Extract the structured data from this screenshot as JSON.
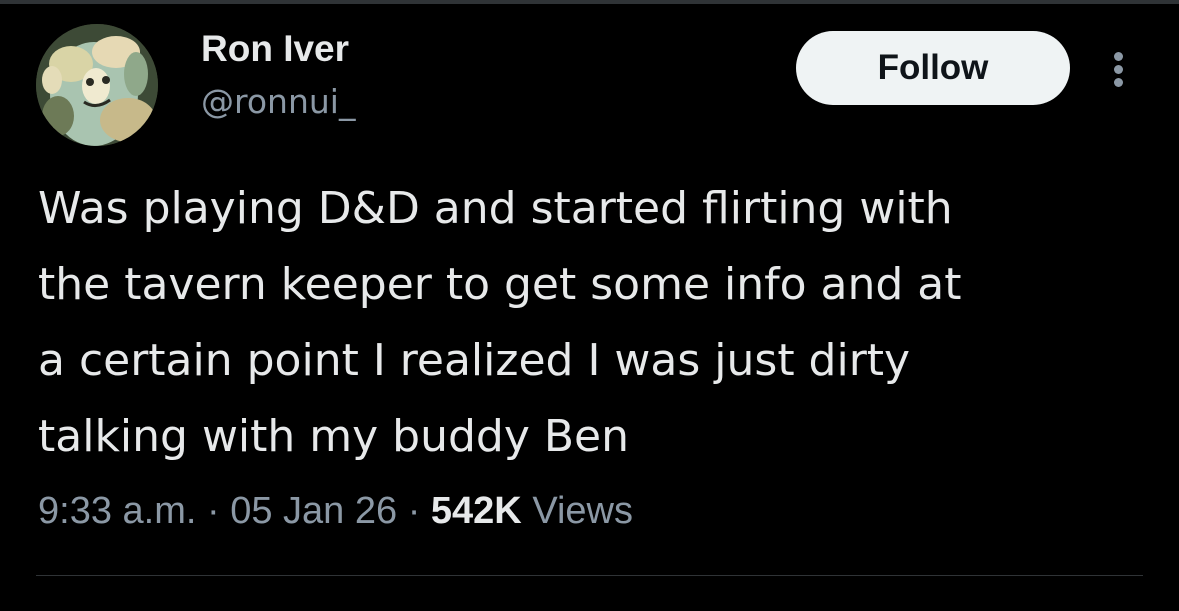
{
  "author": {
    "display_name": "Ron Iver",
    "handle": "@ronnui_"
  },
  "follow_button": {
    "label": "Follow"
  },
  "more_menu": {
    "icon": "more-vertical-icon"
  },
  "tweet": {
    "text_lines": [
      "Was playing D&D and started flirting with",
      "the tavern keeper to get some info and at",
      "a certain point I realized I was just dirty",
      "talking with my buddy Ben"
    ]
  },
  "meta": {
    "time": "9:33 a.m.",
    "separator": "·",
    "date": "05 Jan 26",
    "views_count": "542K",
    "views_label": "Views"
  },
  "colors": {
    "background": "#000000",
    "primary_text": "#e7e9ea",
    "secondary_text": "#8b98a5",
    "button_bg": "#eff3f4",
    "button_text": "#0f1419",
    "divider": "#2f3336"
  }
}
